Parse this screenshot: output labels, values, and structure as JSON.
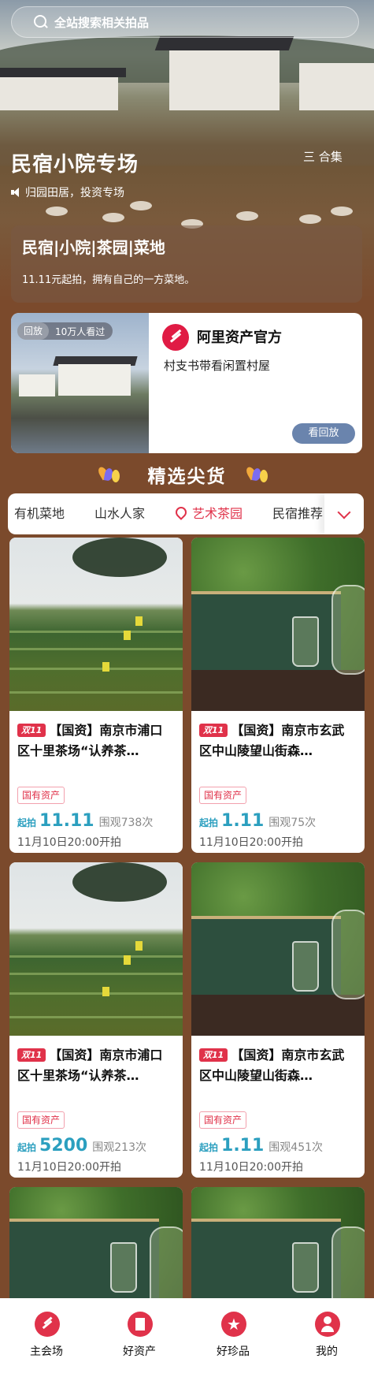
{
  "search": {
    "placeholder": "全站搜索相关拍品"
  },
  "hero": {
    "title": "民宿小院专场",
    "collection": "三 合集",
    "subtitle": "归园田居，投资专场",
    "card_title": "民宿|小院|茶园|菜地",
    "card_desc": "11.11元起拍，拥有自己的一方菜地。"
  },
  "live": {
    "badge_replay": "回放",
    "views": "10万人看过",
    "shop_name": "阿里资产官方",
    "desc": "村支书带看闲置村屋",
    "button": "看回放"
  },
  "section": {
    "title": "精选尖货"
  },
  "tabs": [
    "有机菜地",
    "山水人家",
    "艺术茶园",
    "民宿推荐"
  ],
  "active_tab": "艺术茶园",
  "products": [
    {
      "badge": "双11",
      "title": "【国资】南京市浦口区十里茶场“认养茶…",
      "tag": "国有资产",
      "start_label": "起拍",
      "price": "11.11",
      "views": "围观738次",
      "time": "11月10日20:00开拍"
    },
    {
      "badge": "双11",
      "title": "【国资】南京市玄武区中山陵望山街森…",
      "tag": "国有资产",
      "start_label": "起拍",
      "price": "1.11",
      "views": "围观75次",
      "time": "11月10日20:00开拍"
    },
    {
      "badge": "双11",
      "title": "【国资】南京市浦口区十里茶场“认养茶…",
      "tag": "国有资产",
      "start_label": "起拍",
      "price": "5200",
      "views": "围观213次",
      "time": "11月10日20:00开拍"
    },
    {
      "badge": "双11",
      "title": "【国资】南京市玄武区中山陵望山街森…",
      "tag": "国有资产",
      "start_label": "起拍",
      "price": "1.11",
      "views": "围观451次",
      "time": "11月10日20:00开拍"
    }
  ],
  "nav": [
    {
      "label": "主会场",
      "icon": "home-icon"
    },
    {
      "label": "好资产",
      "icon": "building-icon"
    },
    {
      "label": "好珍品",
      "icon": "star-icon"
    },
    {
      "label": "我的",
      "icon": "user-icon"
    }
  ],
  "colors": {
    "accent": "#e0324a",
    "price": "#2b9fbf",
    "background": "#7b4a2c"
  }
}
